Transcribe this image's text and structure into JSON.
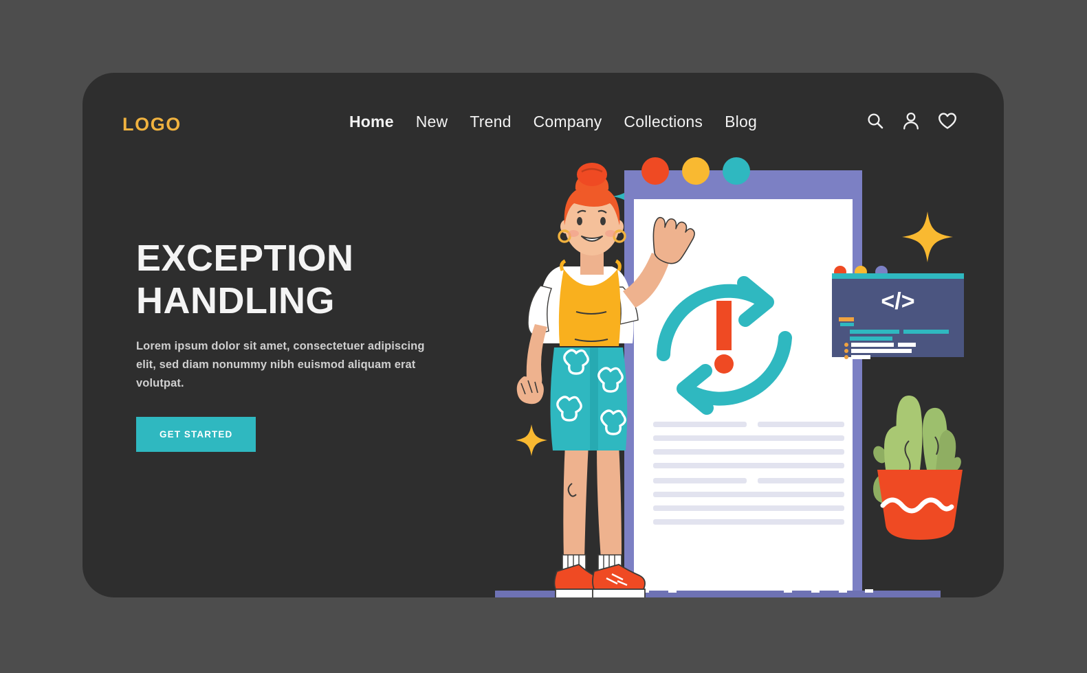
{
  "page": {
    "background_color": "#4d4d4d",
    "card_color": "#2e2e2e"
  },
  "navbar": {
    "logo": "LOGO",
    "logo_color": "#f0b23f",
    "links": [
      {
        "label": "Home",
        "active": true
      },
      {
        "label": "New",
        "active": false
      },
      {
        "label": "Trend",
        "active": false
      },
      {
        "label": "Company",
        "active": false
      },
      {
        "label": "Collections",
        "active": false
      },
      {
        "label": "Blog",
        "active": false
      }
    ],
    "icons": [
      {
        "name": "search-icon"
      },
      {
        "name": "user-icon"
      },
      {
        "name": "heart-icon"
      }
    ]
  },
  "hero": {
    "headline_line1": "EXCEPTION",
    "headline_line2": "HANDLING",
    "subcopy": "Lorem ipsum dolor sit amet, consectetuer adipiscing elit, sed diam nonummy nibh euismod aliquam erat volutpat.",
    "cta_label": "GET STARTED",
    "cta_color": "#2fb8c0"
  },
  "illustration": {
    "name": "exception-handling-illustration",
    "browser_window": {
      "header_color": "#7c80c4",
      "body_color": "#ffffff",
      "dots": [
        {
          "name": "red-dot",
          "color": "#ef4a23"
        },
        {
          "name": "yellow-dot",
          "color": "#f9b931"
        },
        {
          "name": "teal-dot",
          "color": "#2fb8c0"
        }
      ]
    },
    "error_badge": {
      "name": "refresh-error-icon",
      "arrow_color": "#2fb8c0",
      "mark_color": "#ef4a23",
      "symbol": "!"
    },
    "code_panel": {
      "name": "code-snippet-panel",
      "symbol": "</>",
      "panel_color": "#4b5580",
      "accent_color": "#2fb8c0"
    },
    "plant": {
      "name": "potted-plant",
      "leaf_color": "#9dbf6d",
      "pot_color": "#ef4a23"
    },
    "character": {
      "name": "waving-woman",
      "hair_color": "#f05a28",
      "shirt_color": "#ffffff",
      "top_color": "#f9b01e",
      "skirt_color": "#2fb8c0",
      "shoe_color": "#ef4a23"
    },
    "sparkles": [
      {
        "name": "sparkle-teal",
        "color": "#2fb8c0"
      },
      {
        "name": "sparkle-yellow-large",
        "color": "#f9b931"
      },
      {
        "name": "sparkle-yellow-small",
        "color": "#f9b931"
      }
    ]
  }
}
